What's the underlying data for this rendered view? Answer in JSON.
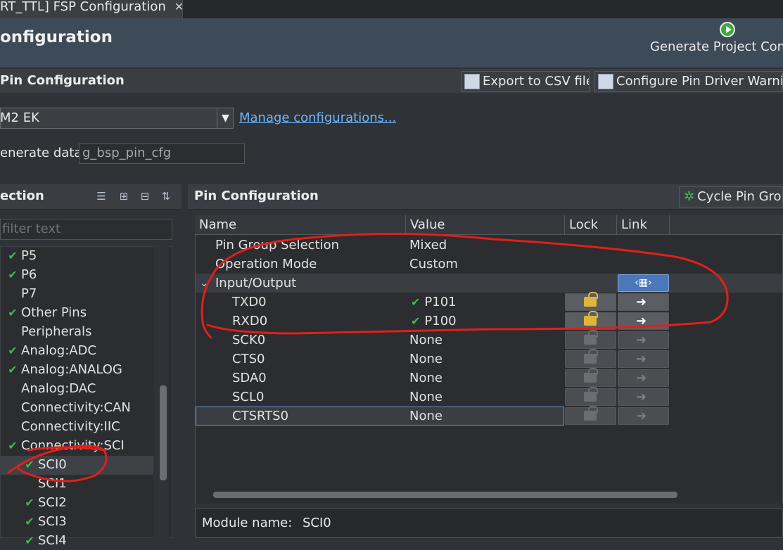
{
  "tab": {
    "title": "RT_TTL] FSP Configuration",
    "close": "✕"
  },
  "header": {
    "title": "onfiguration",
    "generate_label": "Generate Project Cont"
  },
  "pin_config_bar": {
    "title": "Pin Configuration",
    "export_label": "Export to CSV file",
    "warning_label": "Configure Pin Driver Warnin"
  },
  "config_select": {
    "value": "M2 EK",
    "manage_link": "Manage configurations..."
  },
  "generate_data": {
    "label": "enerate data:",
    "value": "g_bsp_pin_cfg"
  },
  "left_panel": {
    "title": "ection",
    "filter_placeholder": "filter text",
    "tree": [
      {
        "label": "P5",
        "check": true,
        "indent": 1
      },
      {
        "label": "P6",
        "check": true,
        "indent": 1
      },
      {
        "label": "P7",
        "check": false,
        "indent": 1
      },
      {
        "label": "Other Pins",
        "check": true,
        "indent": 1
      },
      {
        "label": "Peripherals",
        "check": false,
        "indent": 0
      },
      {
        "label": "Analog:ADC",
        "check": true,
        "indent": 1
      },
      {
        "label": "Analog:ANALOG",
        "check": true,
        "indent": 1
      },
      {
        "label": "Analog:DAC",
        "check": false,
        "indent": 1
      },
      {
        "label": "Connectivity:CAN",
        "check": false,
        "indent": 1
      },
      {
        "label": "Connectivity:IIC",
        "check": false,
        "indent": 1
      },
      {
        "label": "Connectivity:SCI",
        "check": true,
        "indent": 1
      },
      {
        "label": "SCI0",
        "check": true,
        "indent": 2
      },
      {
        "label": "SCI1",
        "check": false,
        "indent": 2
      },
      {
        "label": "SCI2",
        "check": true,
        "indent": 2
      },
      {
        "label": "SCI3",
        "check": true,
        "indent": 2
      },
      {
        "label": "SCI4",
        "check": true,
        "indent": 2
      }
    ]
  },
  "right_panel": {
    "title": "Pin Configuration",
    "cycle_label": "Cycle Pin Grou",
    "columns": [
      "Name",
      "Value",
      "Lock",
      "Link"
    ],
    "rows": [
      {
        "name": "Pin Group Selection",
        "value": "Mixed"
      },
      {
        "name": "Operation Mode",
        "value": "Custom"
      },
      {
        "name": "Input/Output",
        "value": ""
      },
      {
        "name": "TXD0",
        "value": "P101",
        "ok": true
      },
      {
        "name": "RXD0",
        "value": "P100",
        "ok": true
      },
      {
        "name": "SCK0",
        "value": "None"
      },
      {
        "name": "CTS0",
        "value": "None"
      },
      {
        "name": "SDA0",
        "value": "None"
      },
      {
        "name": "SCL0",
        "value": "None"
      },
      {
        "name": "CTSRTS0",
        "value": "None"
      }
    ],
    "expander": "⌄",
    "nav_glyph": "‹▦›",
    "link_arrow": "➜"
  },
  "module": {
    "label": "Module name:",
    "value": "SCI0"
  },
  "colors": {
    "annotation": "#e0201a",
    "check": "#3fb950",
    "lock": "#e0b53a"
  }
}
